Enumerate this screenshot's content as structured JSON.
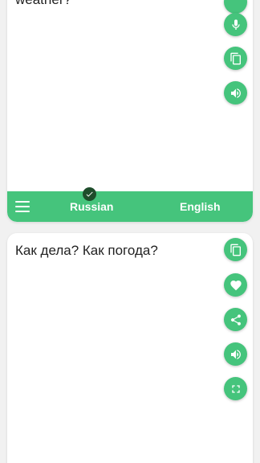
{
  "source_panel": {
    "text": "weather?",
    "buttons": [
      {
        "name": "mic-button",
        "icon": "mic-icon"
      },
      {
        "name": "copy-source-button",
        "icon": "copy-icon"
      },
      {
        "name": "speak-source-button",
        "icon": "volume-icon"
      }
    ]
  },
  "language_bar": {
    "source_language": "Russian",
    "target_language": "English",
    "menu_icon": "hamburger-menu-icon",
    "selected_icon": "check-circle-icon"
  },
  "target_panel": {
    "text": "Как дела? Как погода?",
    "buttons": [
      {
        "name": "copy-translation-button",
        "icon": "copy-icon"
      },
      {
        "name": "favorite-button",
        "icon": "heart-icon"
      },
      {
        "name": "share-button",
        "icon": "share-icon"
      },
      {
        "name": "speak-translation-button",
        "icon": "volume-icon"
      },
      {
        "name": "fullscreen-button",
        "icon": "fullscreen-icon"
      }
    ]
  },
  "colors": {
    "accent": "#45c47c",
    "check_badge": "#1e4d2b",
    "background": "#f1f1f1",
    "card": "#ffffff",
    "text": "#222222"
  }
}
